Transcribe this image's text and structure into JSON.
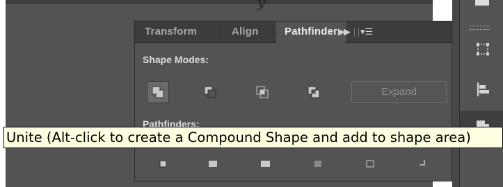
{
  "panel": {
    "tabs": [
      {
        "label": "Transform",
        "active": false
      },
      {
        "label": "Align",
        "active": false
      },
      {
        "label": "Pathfinder",
        "active": true
      }
    ],
    "more_icon": "double-chevron-right-icon",
    "menu_icon": "panel-menu-icon",
    "shape_modes": {
      "label": "Shape Modes:",
      "buttons": [
        {
          "name": "unite",
          "icon": "unite-icon",
          "pressed": true
        },
        {
          "name": "minus-front",
          "icon": "minus-front-icon",
          "pressed": false
        },
        {
          "name": "intersect",
          "icon": "intersect-icon",
          "pressed": false
        },
        {
          "name": "exclude",
          "icon": "exclude-icon",
          "pressed": false
        }
      ],
      "expand_label": "Expand"
    },
    "pathfinders": {
      "label": "Pathfinders:",
      "buttons": [
        {
          "name": "divide",
          "icon": "divide-icon"
        },
        {
          "name": "trim",
          "icon": "trim-icon"
        },
        {
          "name": "merge",
          "icon": "merge-icon"
        },
        {
          "name": "crop",
          "icon": "crop-icon"
        },
        {
          "name": "outline",
          "icon": "outline-icon"
        },
        {
          "name": "minus-back",
          "icon": "minus-back-icon"
        }
      ]
    }
  },
  "tooltip": {
    "text": "Unite (Alt-click to create a Compound Shape and add to shape area)"
  },
  "dock": {
    "icons": [
      "transform-dock-icon",
      "align-dock-icon",
      "pathfinder-dock-icon"
    ]
  },
  "colors": {
    "panel_bg": "#535353",
    "tab_bar": "#3c3c3c",
    "tooltip_bg": "#ffffe1",
    "text_light": "#dddddd"
  }
}
